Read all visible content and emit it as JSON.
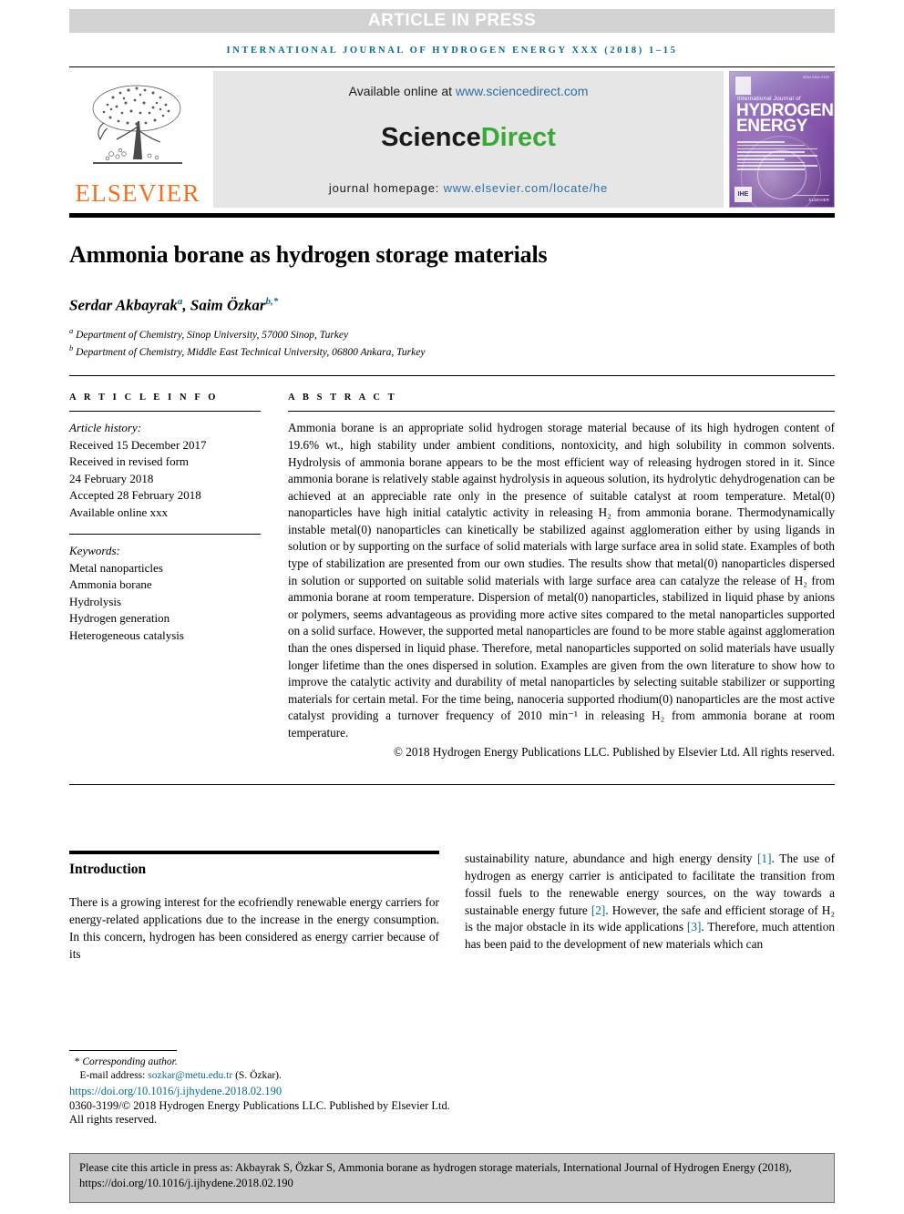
{
  "banner": {
    "article_in_press": "ARTICLE IN PRESS",
    "running_head": "international journal of hydrogen energy xxx (2018) 1–15"
  },
  "masthead": {
    "publisher_name": "ELSEVIER",
    "available_online_label": "Available online at",
    "sciencedirect_url": "www.sciencedirect.com",
    "sciencedirect_logo_part1": "Science",
    "sciencedirect_logo_part2": "Direct",
    "homepage_label": "journal homepage:",
    "homepage_url": "www.elsevier.com/locate/he",
    "cover": {
      "issn": "ISSN 0360-3199",
      "journal_kicker": "International Journal of",
      "title_line1": "HYDROGEN",
      "title_line2": "ENERGY",
      "badge_label": "IHE",
      "publisher": "ELSEVIER"
    }
  },
  "article": {
    "title": "Ammonia borane as hydrogen storage materials",
    "authors": [
      {
        "name": "Serdar Akbayrak",
        "marks": "a"
      },
      {
        "name": "Saim Özkar",
        "marks": "b,*"
      }
    ],
    "affiliations": [
      {
        "mark": "a",
        "text": "Department of Chemistry, Sinop University, 57000 Sinop, Turkey"
      },
      {
        "mark": "b",
        "text": "Department of Chemistry, Middle East Technical University, 06800 Ankara, Turkey"
      }
    ]
  },
  "article_info": {
    "label": "A R T I C L E   I N F O",
    "history_label": "Article history:",
    "history": [
      "Received 15 December 2017",
      "Received in revised form",
      "24 February 2018",
      "Accepted 28 February 2018",
      "Available online xxx"
    ],
    "keywords_label": "Keywords:",
    "keywords": [
      "Metal nanoparticles",
      "Ammonia borane",
      "Hydrolysis",
      "Hydrogen generation",
      "Heterogeneous catalysis"
    ]
  },
  "abstract": {
    "label": "A B S T R A C T",
    "text": "Ammonia borane is an appropriate solid hydrogen storage material because of its high hydrogen content of 19.6% wt., high stability under ambient conditions, nontoxicity, and high solubility in common solvents. Hydrolysis of ammonia borane appears to be the most efficient way of releasing hydrogen stored in it. Since ammonia borane is relatively stable against hydrolysis in aqueous solution, its hydrolytic dehydrogenation can be achieved at an appreciable rate only in the presence of suitable catalyst at room temperature. Metal(0) nanoparticles have high initial catalytic activity in releasing H₂ from ammonia borane. Thermodynamically instable metal(0) nanoparticles can kinetically be stabilized against agglomeration either by using ligands in solution or by supporting on the surface of solid materials with large surface area in solid state. Examples of both type of stabilization are presented from our own studies. The results show that metal(0) nanoparticles dispersed in solution or supported on suitable solid materials with large surface area can catalyze the release of H₂ from ammonia borane at room temperature. Dispersion of metal(0) nanoparticles, stabilized in liquid phase by anions or polymers, seems advantageous as providing more active sites compared to the metal nanoparticles supported on a solid surface. However, the supported metal nanoparticles are found to be more stable against agglomeration than the ones dispersed in liquid phase. Therefore, metal nanoparticles supported on solid materials have usually longer lifetime than the ones dispersed in solution. Examples are given from the own literature to show how to improve the catalytic activity and durability of metal nanoparticles by selecting suitable stabilizer or supporting materials for certain metal. For the time being, nanoceria supported rhodium(0) nanoparticles are the most active catalyst providing a turnover frequency of 2010 min⁻¹ in releasing H₂ from ammonia borane at room temperature.",
    "copyright": "© 2018 Hydrogen Energy Publications LLC. Published by Elsevier Ltd. All rights reserved."
  },
  "introduction": {
    "heading": "Introduction",
    "col_left": "There is a growing interest for the ecofriendly renewable energy carriers for energy-related applications due to the increase in the energy consumption. In this concern, hydrogen has been considered as energy carrier because of its",
    "col_right_parts": [
      {
        "t": "sustainability nature, abundance and high energy density "
      },
      {
        "t": "[1]",
        "cite": true
      },
      {
        "t": ". The use of hydrogen as energy carrier is anticipated to facilitate the transition from fossil fuels to the renewable energy sources, on the way towards a sustainable energy future "
      },
      {
        "t": "[2]",
        "cite": true
      },
      {
        "t": ". However, the safe and efficient storage of H₂ is the major obstacle in its wide applications "
      },
      {
        "t": "[3]",
        "cite": true
      },
      {
        "t": ". Therefore, much attention has been paid to the development of new materials which can"
      }
    ]
  },
  "footer": {
    "corresponding_marker": "*",
    "corresponding_label": "Corresponding author.",
    "email_label": "E-mail address:",
    "email": "sozkar@metu.edu.tr",
    "email_owner": "(S. Özkar).",
    "doi": "https://doi.org/10.1016/j.ijhydene.2018.02.190",
    "issn_copyright": "0360-3199/© 2018 Hydrogen Energy Publications LLC. Published by Elsevier Ltd. All rights reserved.",
    "cite_notice": "Please cite this article in press as: Akbayrak S, Özkar S, Ammonia borane as hydrogen storage materials, International Journal of Hydrogen Energy (2018), https://doi.org/10.1016/j.ijhydene.2018.02.190"
  },
  "colors": {
    "journal_teal": "#0b6c91",
    "link_blue": "#2e6da4",
    "sciencedirect_green": "#39a935",
    "elsevier_orange": "#f37021",
    "banner_gray": "#d2d2d2",
    "cite_box_gray": "#c8c8c8"
  }
}
